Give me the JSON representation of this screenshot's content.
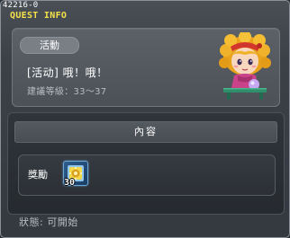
{
  "window": {
    "quest_id": "42216-0",
    "title": "QUEST INFO"
  },
  "info": {
    "badge": "活動",
    "quest_name": "[活动] 哦！哦！",
    "level_label": "建議等級：33～37"
  },
  "content": {
    "header": "內容",
    "reward_label": "獎勵",
    "reward_item": {
      "icon": "reward-item-icon",
      "quantity": "30"
    }
  },
  "status": {
    "text": "狀態:  可開始"
  },
  "colors": {
    "title": "#f5e14a",
    "panel": "#4c5158",
    "content_bg": "#262a2f"
  }
}
